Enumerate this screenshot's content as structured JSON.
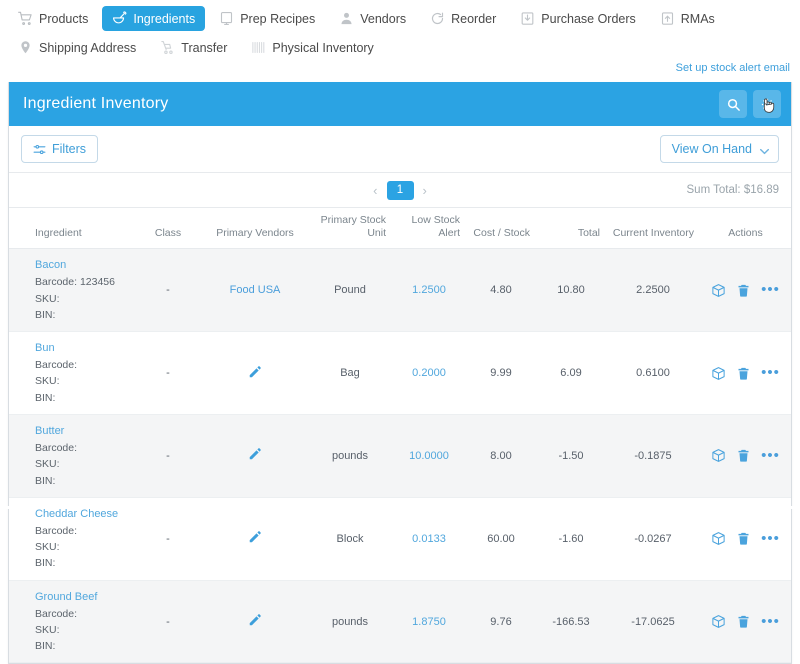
{
  "nav": {
    "tabs": [
      {
        "label": "Products",
        "icon": "cart-icon",
        "active": false
      },
      {
        "label": "Ingredients",
        "icon": "mortar-bowl-icon",
        "active": true
      },
      {
        "label": "Prep Recipes",
        "icon": "tablet-icon",
        "active": false
      },
      {
        "label": "Vendors",
        "icon": "user-icon",
        "active": false
      },
      {
        "label": "Reorder",
        "icon": "refresh-icon",
        "active": false
      },
      {
        "label": "Purchase Orders",
        "icon": "inbox-down-icon",
        "active": false
      },
      {
        "label": "RMAs",
        "icon": "box-up-icon",
        "active": false
      },
      {
        "label": "Shipping Address",
        "icon": "map-pin-icon",
        "active": false
      },
      {
        "label": "Transfer",
        "icon": "hand-truck-icon",
        "active": false
      },
      {
        "label": "Physical Inventory",
        "icon": "inventory-icon",
        "active": false
      }
    ],
    "stock_alert_link": "Set up stock alert email"
  },
  "panel": {
    "title": "Ingredient Inventory",
    "search_icon": "search-icon",
    "secondary_icon": "cursor-hand-icon"
  },
  "toolbar": {
    "filters_label": "Filters",
    "view_label": "View On Hand"
  },
  "pagination": {
    "prev": "‹",
    "page": "1",
    "next": "›",
    "sum_total": "Sum Total: $16.89"
  },
  "table": {
    "headers": [
      "Ingredient",
      "Class",
      "Primary Vendors",
      "Primary Stock Unit",
      "Low Stock Alert",
      "Cost / Stock",
      "Total",
      "Current Inventory",
      "Actions"
    ],
    "meta_labels": {
      "barcode": "Barcode:",
      "sku": "SKU:",
      "bin": "BIN:"
    },
    "rows": [
      {
        "ingredient": "Bacon",
        "barcode": "Barcode: 123456",
        "sku": "SKU:",
        "bin": "BIN:",
        "class": "-",
        "vendor": "Food USA",
        "vendor_is_link": true,
        "unit": "Pound",
        "low_stock_alert": "1.2500",
        "cost_per_stock": "4.80",
        "total": "10.80",
        "current_inventory": "2.2500"
      },
      {
        "ingredient": "Bun",
        "barcode": "Barcode:",
        "sku": "SKU:",
        "bin": "BIN:",
        "class": "-",
        "vendor": "",
        "vendor_is_link": false,
        "unit": "Bag",
        "low_stock_alert": "0.2000",
        "cost_per_stock": "9.99",
        "total": "6.09",
        "current_inventory": "0.6100"
      },
      {
        "ingredient": "Butter",
        "barcode": "Barcode:",
        "sku": "SKU:",
        "bin": "BIN:",
        "class": "-",
        "vendor": "",
        "vendor_is_link": false,
        "unit": "pounds",
        "low_stock_alert": "10.0000",
        "cost_per_stock": "8.00",
        "total": "-1.50",
        "current_inventory": "-0.1875"
      },
      {
        "ingredient": "Cheddar Cheese",
        "barcode": "Barcode:",
        "sku": "SKU:",
        "bin": "BIN:",
        "class": "-",
        "vendor": "",
        "vendor_is_link": false,
        "unit": "Block",
        "low_stock_alert": "0.0133",
        "cost_per_stock": "60.00",
        "total": "-1.60",
        "current_inventory": "-0.0267"
      },
      {
        "ingredient": "Ground Beef",
        "barcode": "Barcode:",
        "sku": "SKU:",
        "bin": "BIN:",
        "class": "-",
        "vendor": "",
        "vendor_is_link": false,
        "unit": "pounds",
        "low_stock_alert": "1.8750",
        "cost_per_stock": "9.76",
        "total": "-166.53",
        "current_inventory": "-17.0625"
      }
    ],
    "row_actions": {
      "box_icon": "box-icon",
      "trash_icon": "trash-icon",
      "more_icon": "ellipsis-icon",
      "more_label": "•••"
    }
  },
  "colors": {
    "accent": "#2ba3e3",
    "link": "#51a7dd",
    "panel_border": "#d8dde2",
    "row_alt": "#f4f5f6",
    "muted_text": "#7b858d"
  }
}
